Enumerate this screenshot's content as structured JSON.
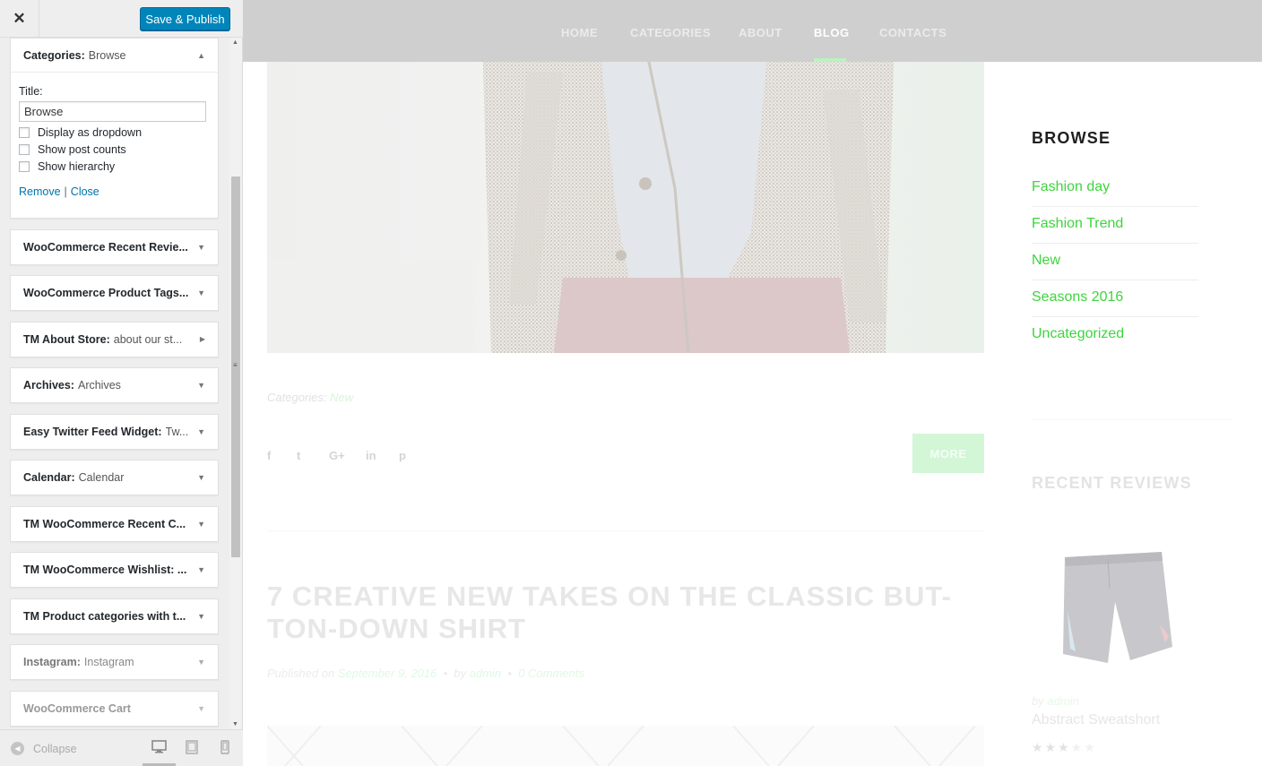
{
  "sidebar": {
    "close_glyph": "✕",
    "publish_label": "Save & Publish",
    "active_widget": {
      "name": "Categories:",
      "title": "Browse",
      "title_field_label": "Title:",
      "title_value": "Browse",
      "options": [
        {
          "label": "Display as dropdown",
          "checked": false
        },
        {
          "label": "Show post counts",
          "checked": false
        },
        {
          "label": "Show hierarchy",
          "checked": false
        }
      ],
      "remove_label": "Remove",
      "separator": "|",
      "close_label": "Close"
    },
    "widgets": [
      {
        "name": "WooCommerce Recent Revie...",
        "sub": ""
      },
      {
        "name": "WooCommerce Product Tags...",
        "sub": ""
      },
      {
        "name": "TM About Store:",
        "sub": "about our st..."
      },
      {
        "name": "Archives:",
        "sub": "Archives"
      },
      {
        "name": "Easy Twitter Feed Widget:",
        "sub": "Tw..."
      },
      {
        "name": "Calendar:",
        "sub": "Calendar"
      },
      {
        "name": "TM WooCommerce Recent C...",
        "sub": ""
      },
      {
        "name": "TM WooCommerce Wishlist: ...",
        "sub": ""
      },
      {
        "name": "TM Product categories with t...",
        "sub": ""
      },
      {
        "name": "Instagram:",
        "sub": "Instagram"
      },
      {
        "name": "WooCommerce Cart",
        "sub": ""
      }
    ],
    "footer": {
      "collapse_label": "Collapse"
    }
  },
  "preview": {
    "nav": [
      "HOME",
      "CATEGORIES",
      "ABOUT",
      "BLOG",
      "CONTACTS"
    ],
    "active_nav": "BLOG",
    "post_categories_label": "Categories:",
    "post_category": "New",
    "more_label": "MORE",
    "share_icons": [
      "f",
      "t",
      "G+",
      "in",
      "p"
    ],
    "next_post_title": "7 CREATIVE NEW TAKES ON THE CLASSIC BUT-TON-DOWN SHIRT",
    "next_post_meta": {
      "published_on": "Published on",
      "date": "September 9, 2016",
      "by": "by",
      "author": "admin",
      "comments": "0 Comments"
    },
    "browse_title": "BROWSE",
    "browse_items": [
      "Fashion day",
      "Fashion Trend",
      "New",
      "Seasons 2016",
      "Uncategorized"
    ],
    "recent_reviews_title": "RECENT REVIEWS",
    "review": {
      "by": "by",
      "author": "admin",
      "product": "Abstract Sweatshort",
      "rating": 3,
      "rating_max": 5
    },
    "colors": {
      "accent_green": "#3ed43e",
      "publish_blue": "#0085ba",
      "nav_bg": "#cfcfcf"
    }
  }
}
